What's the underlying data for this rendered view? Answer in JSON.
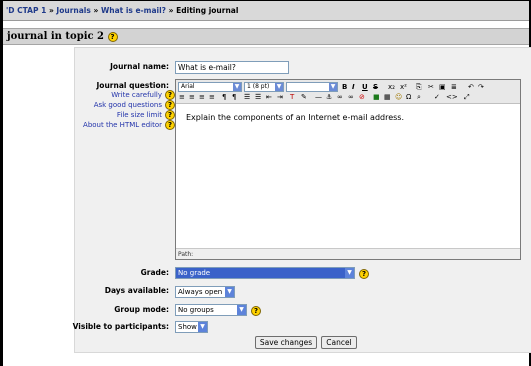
{
  "breadcrumb": {
    "course": "'D CTAP 1",
    "journals": "Journals",
    "journal": "What is e-mail?",
    "current": "Editing journal",
    "sep": "»"
  },
  "heading": "journal in topic 2",
  "help_icon_glyph": "?",
  "form": {
    "journal_name_label": "Journal name:",
    "journal_name_value": "What is e-mail?",
    "journal_question_label": "Journal question:",
    "help_links": [
      "Write carefully",
      "Ask good questions",
      "File size limit",
      "About the HTML editor"
    ],
    "editor": {
      "font": "Arial",
      "size": "1 (8 pt)",
      "style": "",
      "content": "Explain the components of an Internet e-mail address.",
      "path_label": "Path:"
    },
    "grade_label": "Grade:",
    "grade_value": "No grade",
    "days_label": "Days available:",
    "days_value": "Always open",
    "group_label": "Group mode:",
    "group_value": "No groups",
    "visible_label": "Visible to participants:",
    "visible_value": "Show",
    "save_button": "Save changes",
    "cancel_button": "Cancel"
  },
  "colors": {
    "link": "#1f3a8a",
    "help_icon": "#ffd200",
    "grade_highlight": "#3a62c9"
  }
}
